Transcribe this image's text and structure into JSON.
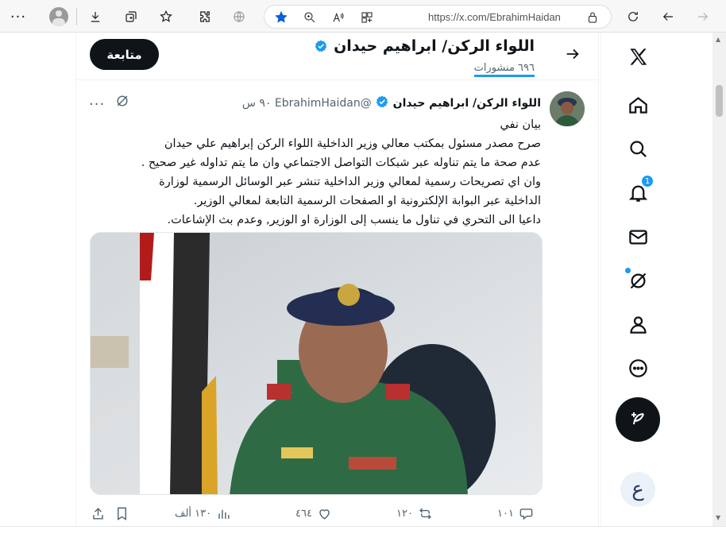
{
  "browser": {
    "url": "https://x.com/EbrahimHaidan"
  },
  "header": {
    "title": "اللواء الركن/ ابراهيم حيدان",
    "posts_count": "٦٩٦ منشورات",
    "follow_label": "متابعة"
  },
  "tweet": {
    "name": "اللواء الركن/ ابراهيم حيدان",
    "handle": "@EbrahimHaidan",
    "time": "٩٠ س",
    "lines": [
      "بيان نفي",
      "صرح مصدر مسئول بمكتب معالي وزير الداخلية اللواء الركن إبراهيم علي حيدان",
      "عدم صحة ما يتم تناوله عبر شبكات التواصل الاجتماعي وان ما يتم تداوله غير صحيح .",
      "وان اي تصريحات رسمية لمعالي وزير الداخلية تنشر عبر الوسائل الرسمية لوزارة",
      "الداخلية عبر البوابة الإلكترونية او الصفحات الرسمية  التابعة لمعالي الوزير.",
      "داعيا الى التحري في تناول ما ينسب إلى الوزارة او الوزير, وعدم بث الإشاعات."
    ],
    "replies": "١٠١",
    "reposts": "١٢٠",
    "likes": "٤٦٤",
    "views": "١٣٠ ألف"
  },
  "nav": {
    "notifications_badge": "1"
  },
  "colors": {
    "accent": "#1d9bf0",
    "text": "#0f1419",
    "muted": "#536471"
  }
}
